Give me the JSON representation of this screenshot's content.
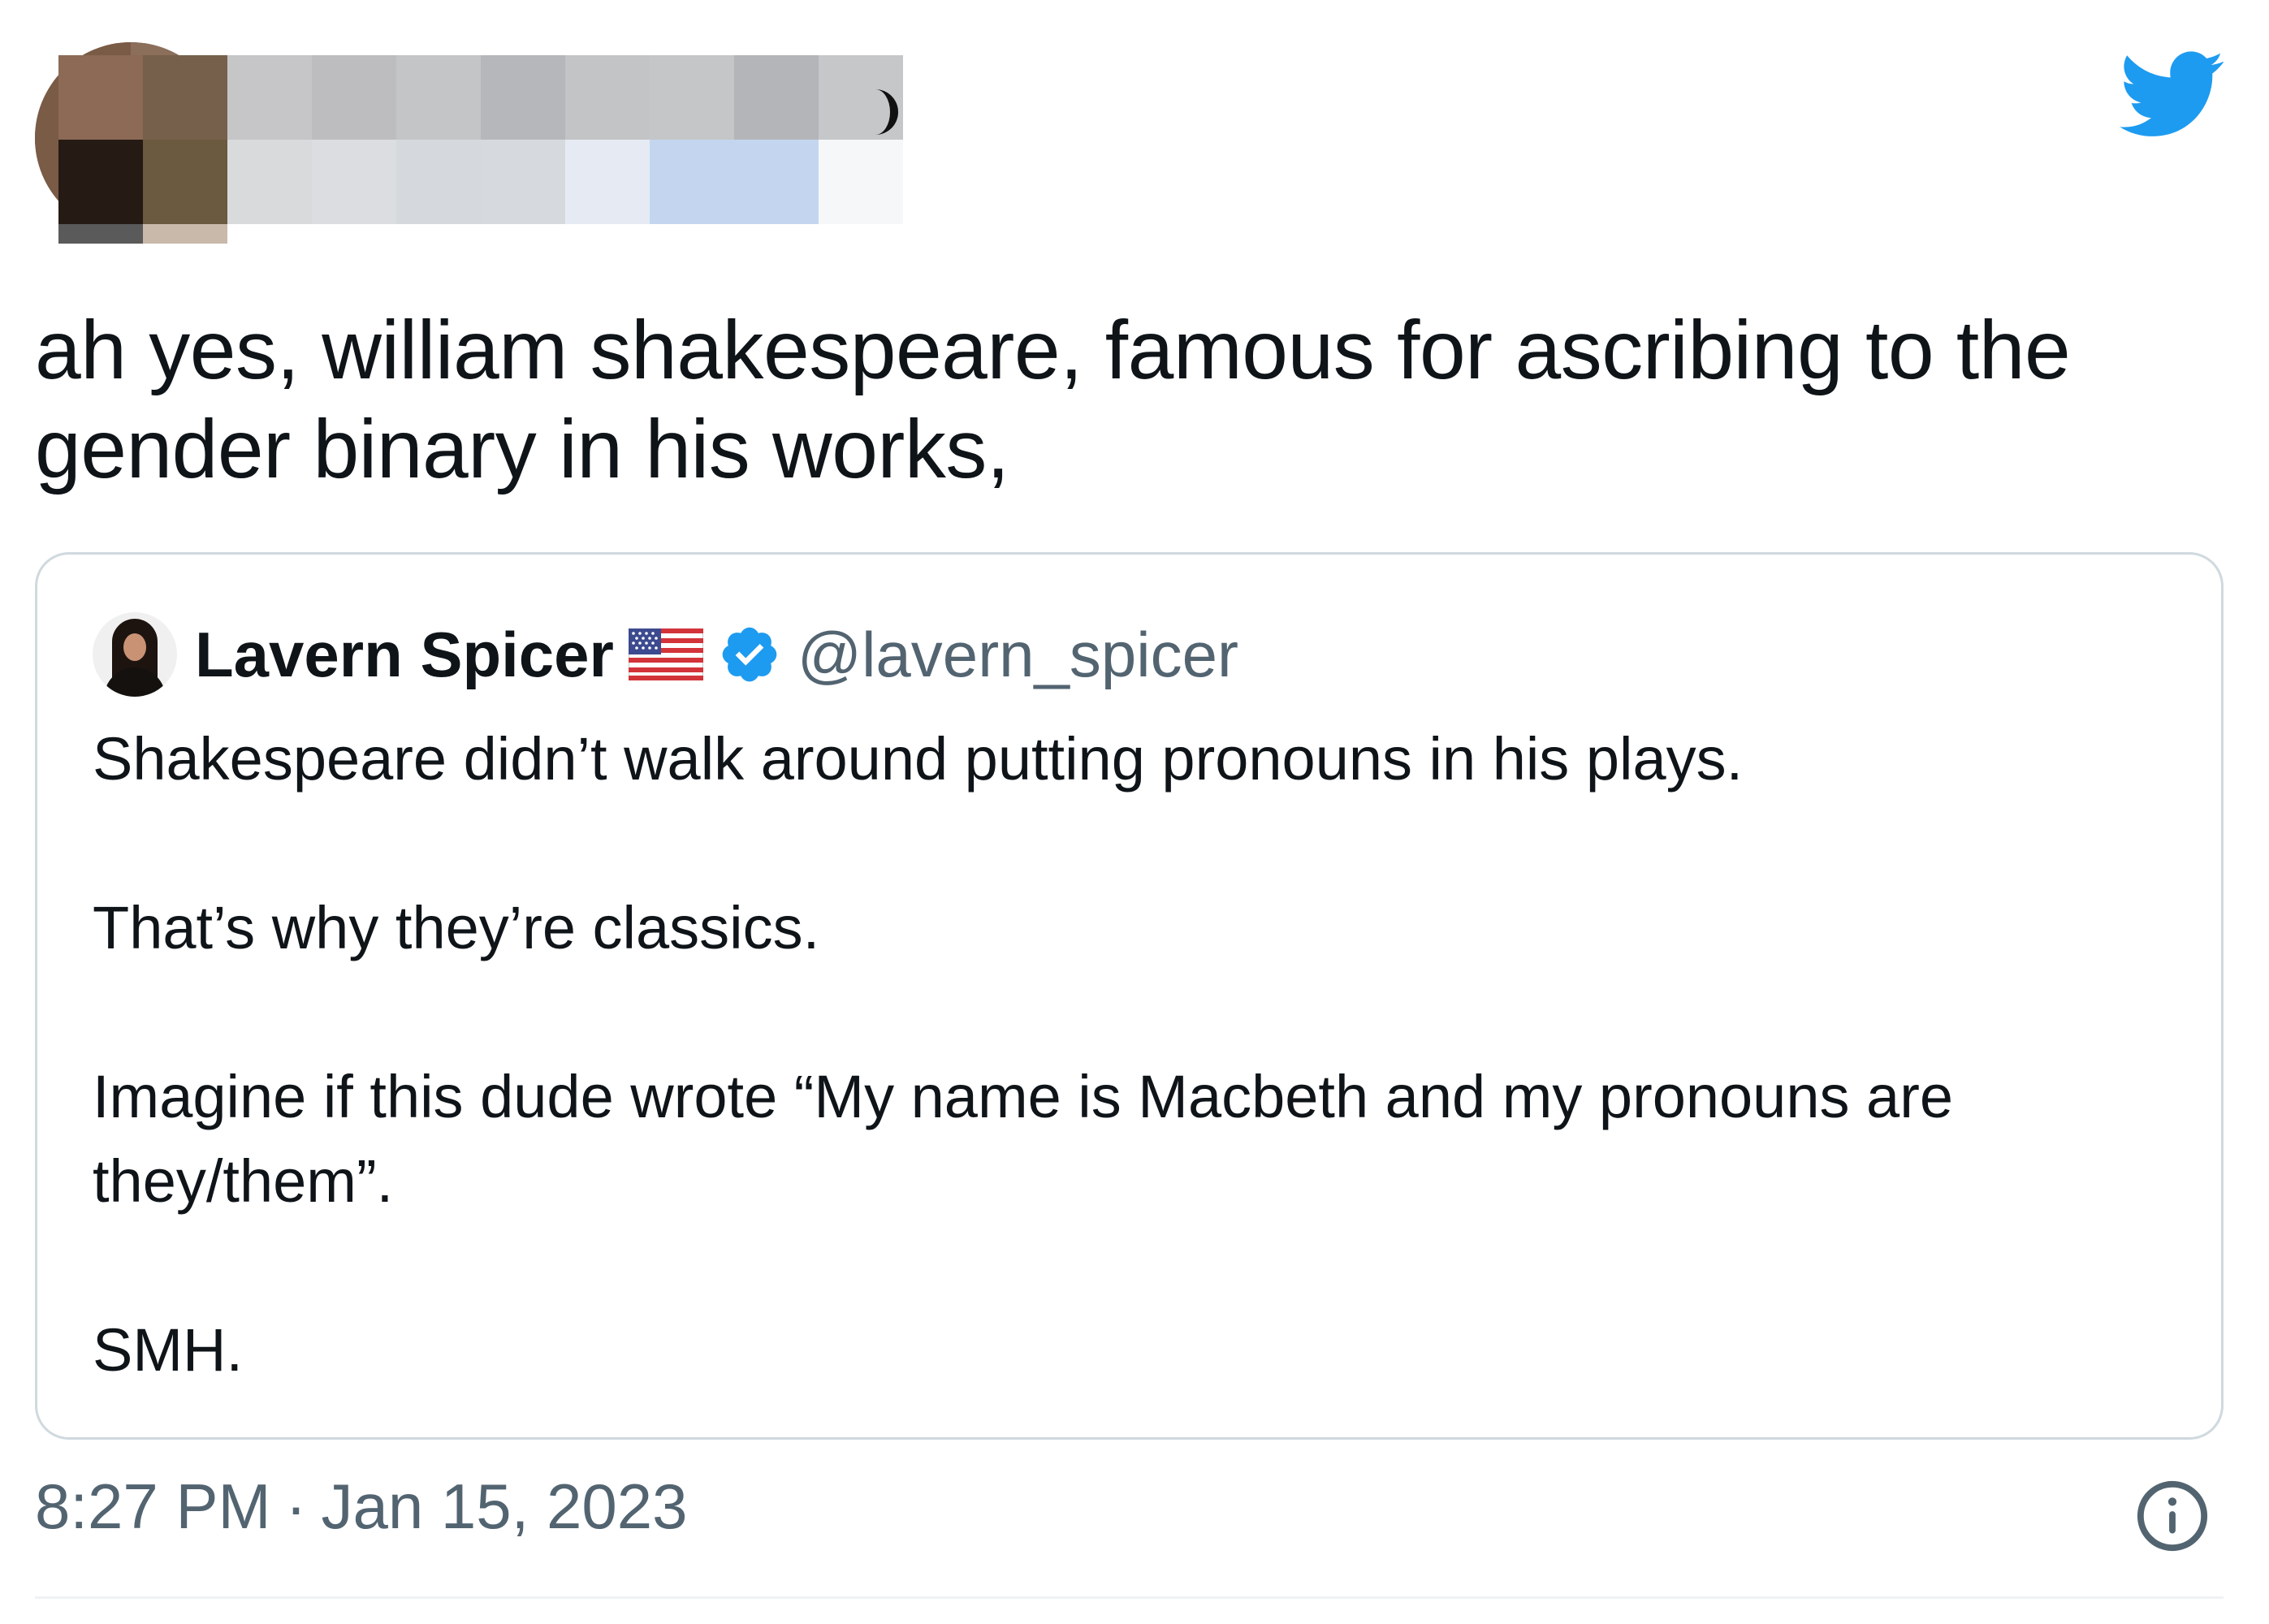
{
  "author": {
    "name_censored": true,
    "avatar": "censored-avatar"
  },
  "icons": {
    "brand": "twitter-bird-icon",
    "info": "info-icon",
    "flag": "us-flag-icon",
    "verified": "verified-badge-icon"
  },
  "colors": {
    "twitter_blue": "#1d9bf0",
    "text_primary": "#0f1419",
    "text_secondary": "#536471",
    "border": "#cfd9de"
  },
  "tweet": {
    "text": "ah yes, william shakespeare, famous for ascribing to the gender binary in his works,"
  },
  "quote": {
    "name": "Lavern Spicer",
    "handle": "@lavern_spicer",
    "paragraphs": [
      "Shakespeare didn’t walk around putting pronouns in his plays.",
      "That’s why they’re classics.",
      "Imagine if this dude wrote “My name is Macbeth and my pronouns are they/them”.",
      "SMH."
    ]
  },
  "meta": {
    "time": "8:27 PM",
    "separator": "·",
    "date": "Jan 15, 2023"
  }
}
